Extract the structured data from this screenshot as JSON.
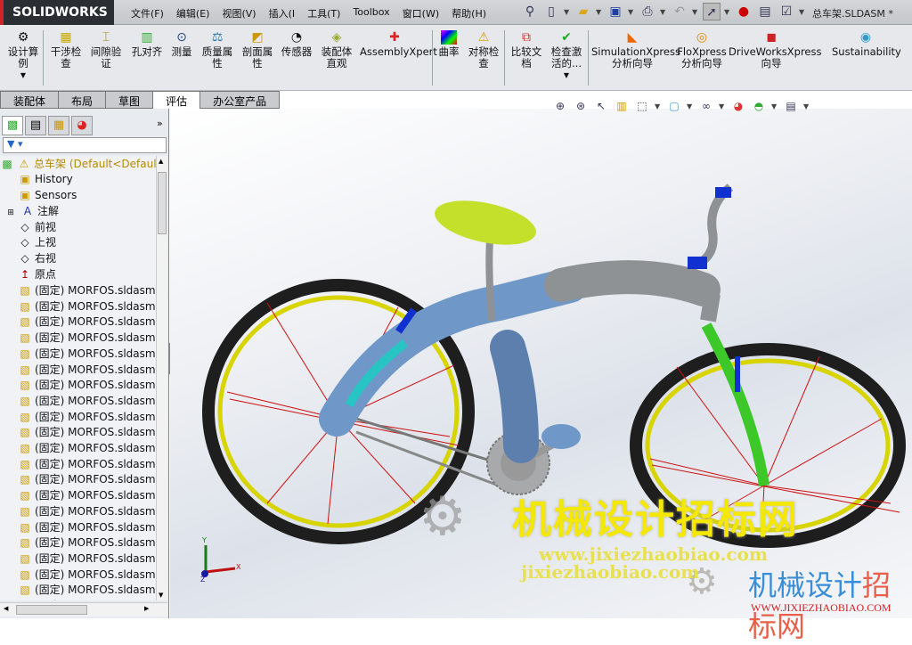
{
  "app": {
    "logo": "SOLIDWORKS",
    "document_title": "总车架.SLDASM *"
  },
  "menu": [
    "文件(F)",
    "编辑(E)",
    "视图(V)",
    "插入(I",
    "工具(T)",
    "Toolbox",
    "窗口(W)",
    "帮助(H)"
  ],
  "quick_access": [
    {
      "icon": "pin-icon"
    },
    {
      "icon": "new-document-icon"
    },
    {
      "icon": "open-folder-icon"
    },
    {
      "icon": "save-icon"
    },
    {
      "icon": "print-icon"
    },
    {
      "icon": "undo-icon"
    },
    {
      "icon": "select-arrow-icon"
    },
    {
      "icon": "rebuild-traffic-light-icon"
    },
    {
      "icon": "file-properties-icon"
    },
    {
      "icon": "options-list-icon"
    }
  ],
  "ribbon": [
    {
      "label": "设计算例",
      "icon": "design-study-icon"
    },
    {
      "label": "干涉检查",
      "icon": "interference-icon"
    },
    {
      "label": "间隙验证",
      "icon": "clearance-icon"
    },
    {
      "label": "孔对齐",
      "icon": "hole-alignment-icon"
    },
    {
      "label": "测量",
      "icon": "measure-icon"
    },
    {
      "label": "质量属性",
      "icon": "mass-properties-icon"
    },
    {
      "label": "剖面属性",
      "icon": "section-properties-icon"
    },
    {
      "label": "传感器",
      "icon": "sensor-icon"
    },
    {
      "label": "装配体直观",
      "icon": "assembly-visualization-icon"
    },
    {
      "label": "AssemblyXpert",
      "icon": "assemblyxpert-icon"
    },
    {
      "label": "曲率",
      "icon": "curvature-icon"
    },
    {
      "label": "对称检查",
      "icon": "symmetry-check-icon"
    },
    {
      "label": "比较文档",
      "icon": "compare-documents-icon"
    },
    {
      "label": "检查激活的...",
      "icon": "check-active-icon"
    },
    {
      "label": "SimulationXpress 分析向导",
      "icon": "simulationxpress-icon"
    },
    {
      "label": "FloXpress 分析向导",
      "icon": "floxpress-icon"
    },
    {
      "label": "DriveWorksXpress 向导",
      "icon": "driveworksxpress-icon"
    },
    {
      "label": "Sustainability",
      "icon": "sustainability-icon"
    }
  ],
  "command_tabs": [
    "装配体",
    "布局",
    "草图",
    "评估",
    "办公室产品"
  ],
  "active_command_tab": "评估",
  "panel": {
    "tabs": [
      {
        "icon": "feature-manager-icon"
      },
      {
        "icon": "property-manager-icon"
      },
      {
        "icon": "configuration-manager-icon"
      },
      {
        "icon": "display-manager-icon"
      }
    ],
    "expand": "»",
    "filter_icon": "filter-icon",
    "tree": {
      "root": {
        "name": "总车架",
        "config": "(Default<Default"
      },
      "items": [
        {
          "label": "History",
          "icon": "history-folder-icon"
        },
        {
          "label": "Sensors",
          "icon": "sensors-folder-icon"
        },
        {
          "label": "注解",
          "icon": "annotations-folder-icon",
          "expandable": true
        },
        {
          "label": "前视",
          "icon": "plane-icon"
        },
        {
          "label": "上视",
          "icon": "plane-icon"
        },
        {
          "label": "右视",
          "icon": "plane-icon"
        },
        {
          "label": "原点",
          "icon": "origin-icon"
        }
      ],
      "component_label": "(固定) MORFOS.sldasm-",
      "component_count_visible": 21
    }
  },
  "heads_up_toolbar": [
    {
      "icon": "zoom-to-fit-icon"
    },
    {
      "icon": "zoom-to-area-icon"
    },
    {
      "icon": "previous-view-icon"
    },
    {
      "icon": "section-view-icon"
    },
    {
      "icon": "view-orientation-icon"
    },
    {
      "icon": "display-style-icon"
    },
    {
      "icon": "hide-show-items-icon"
    },
    {
      "icon": "edit-appearance-icon"
    },
    {
      "icon": "apply-scene-icon"
    },
    {
      "icon": "view-settings-icon"
    }
  ],
  "triad": {
    "x": "X",
    "y": "Y",
    "z": "Z"
  },
  "watermark": {
    "cn": "机械设计招标网",
    "url1": "www.jixiezhaobiao.com",
    "url2": "jixiezhaobiao.com",
    "cn2a": "机械设计",
    "cn2b": "招标网",
    "url3": "WWW.JIXIEZHAOBIAO.COM"
  },
  "colors": {
    "frame": "#6f98c8",
    "frame_gray": "#8f9294",
    "fork": "#3cc828",
    "seat": "#c4e02a",
    "rim": "#d8d400",
    "tire": "#1e1e1e",
    "spokes": "#cc1010",
    "brackets": "#1030d0"
  }
}
